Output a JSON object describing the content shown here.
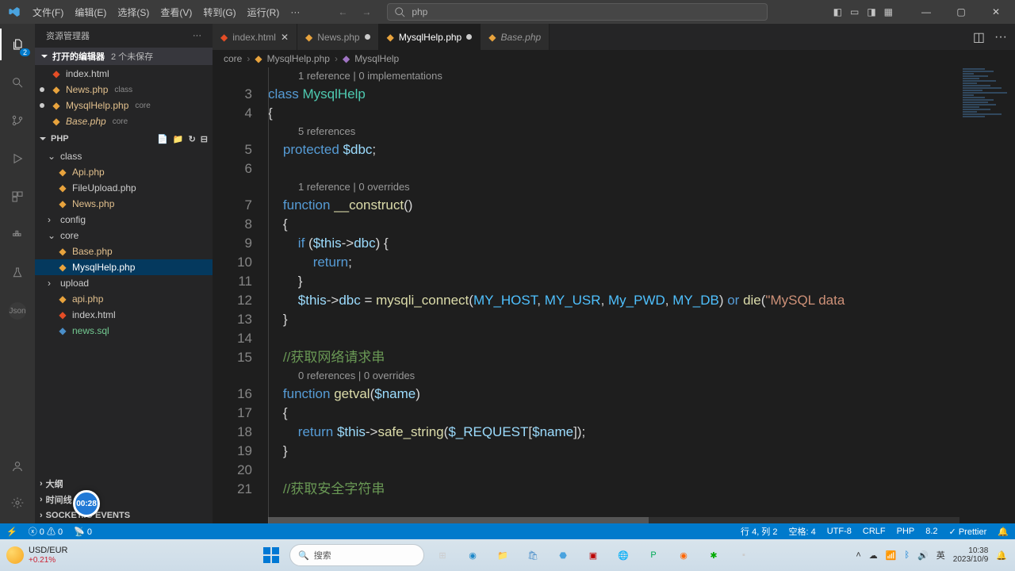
{
  "titlebar": {
    "menu": [
      "文件(F)",
      "编辑(E)",
      "选择(S)",
      "查看(V)",
      "转到(G)",
      "运行(R)"
    ],
    "dots": "···",
    "search_text": "php"
  },
  "activitybar": {
    "explorer_badge": "2"
  },
  "sidebar": {
    "title": "资源管理器",
    "more": "···",
    "open_editors": {
      "label": "打开的编辑器",
      "count": "2 个未保存"
    },
    "open_editor_items": [
      {
        "name": "index.html",
        "suffix": "",
        "mod": false,
        "icon": "html"
      },
      {
        "name": "News.php",
        "suffix": "class",
        "mod": true,
        "icon": "php",
        "git": "mod"
      },
      {
        "name": "MysqlHelp.php",
        "suffix": "core",
        "mod": true,
        "icon": "php",
        "git": "mod",
        "selected": false
      },
      {
        "name": "Base.php",
        "suffix": "core",
        "mod": false,
        "icon": "php",
        "git": "mod",
        "italic": true
      }
    ],
    "root": "PHP",
    "tree": {
      "class": {
        "label": "class",
        "children": [
          {
            "name": "Api.php",
            "icon": "php",
            "git": "mod"
          },
          {
            "name": "FileUpload.php",
            "icon": "php"
          },
          {
            "name": "News.php",
            "icon": "php",
            "git": "mod"
          }
        ]
      },
      "config": {
        "label": "config"
      },
      "core": {
        "label": "core",
        "children": [
          {
            "name": "Base.php",
            "icon": "php",
            "git": "mod"
          },
          {
            "name": "MysqlHelp.php",
            "icon": "php",
            "git": "mod",
            "selected": true
          }
        ]
      },
      "upload": {
        "label": "upload"
      },
      "root_files": [
        {
          "name": "api.php",
          "icon": "php",
          "git": "mod"
        },
        {
          "name": "index.html",
          "icon": "html"
        },
        {
          "name": "news.sql",
          "icon": "db",
          "git": "untracked"
        }
      ]
    },
    "collapsed": [
      "大纲",
      "时间线",
      "SOCKET.IO EVENTS"
    ]
  },
  "tabs": {
    "items": [
      {
        "name": "index.html",
        "icon": "html",
        "active": false,
        "dirty": false
      },
      {
        "name": "News.php",
        "icon": "php",
        "active": false,
        "dirty": true
      },
      {
        "name": "MysqlHelp.php",
        "icon": "php",
        "active": true,
        "dirty": true
      },
      {
        "name": "Base.php",
        "icon": "php",
        "active": false,
        "dirty": false,
        "italic": true
      }
    ]
  },
  "breadcrumb": [
    "core",
    "MysqlHelp.php",
    "MysqlHelp"
  ],
  "code": {
    "codelens1": "1 reference | 0 implementations",
    "codelens2": "5 references",
    "codelens3": "1 reference | 0 overrides",
    "codelens4": "0 references | 0 overrides",
    "l3": {
      "kw": "class",
      "cls": "MysqlHelp"
    },
    "l4": "{",
    "l5": {
      "kw": "protected",
      "var": "$dbc",
      "end": ";"
    },
    "l6": "",
    "l7": {
      "kw": "function",
      "fn": "__construct",
      "paren": "()"
    },
    "l8": "{",
    "l9": {
      "kw": "if",
      "op": " (",
      "var": "$this",
      "arrow": "->",
      "prop": "dbc",
      "close": ") {"
    },
    "l10": {
      "kw": "return",
      "end": ";"
    },
    "l11": "}",
    "l12": {
      "var": "$this",
      "arrow": "->",
      "prop": "dbc",
      "eq": " = ",
      "fn": "mysqli_connect",
      "args_open": "(",
      "c1": "MY_HOST",
      "c2": "MY_USR",
      "c3": "My_PWD",
      "c4": "MY_DB",
      "args_close": ")",
      "or": " or ",
      "die": "die",
      "po": "(",
      "str": "\"MySQL data"
    },
    "l13": "}",
    "l14": "",
    "l15": "//获取网络请求串",
    "l16": {
      "kw": "function",
      "fn": "getval",
      "open": "(",
      "var": "$name",
      "close": ")"
    },
    "l17": "{",
    "l18": {
      "kw": "return",
      "var1": "$this",
      "arrow": "->",
      "fn": "safe_string",
      "open": "(",
      "req": "$_REQUEST",
      "br1": "[",
      "var2": "$name",
      "br2": "]",
      "close": ");"
    },
    "l19": "}",
    "l20": "",
    "l21": "//获取安全字符串"
  },
  "line_numbers": [
    "3",
    "4",
    "5",
    "6",
    "7",
    "8",
    "9",
    "10",
    "11",
    "12",
    "13",
    "14",
    "15",
    "16",
    "17",
    "18",
    "19",
    "20",
    "21"
  ],
  "statusbar": {
    "errors": "0",
    "warnings": "0",
    "ports": "0",
    "cursor": "行 4, 列 2",
    "spaces": "空格: 4",
    "encoding": "UTF-8",
    "eol": "CRLF",
    "lang": "PHP",
    "phpver": "8.2",
    "prettier": "Prettier"
  },
  "taskbar": {
    "weather": {
      "pair": "USD/EUR",
      "delta": "+0.21%"
    },
    "search": "搜索",
    "time": "10:38",
    "date": "2023/10/9"
  },
  "rec_time": "00:28"
}
